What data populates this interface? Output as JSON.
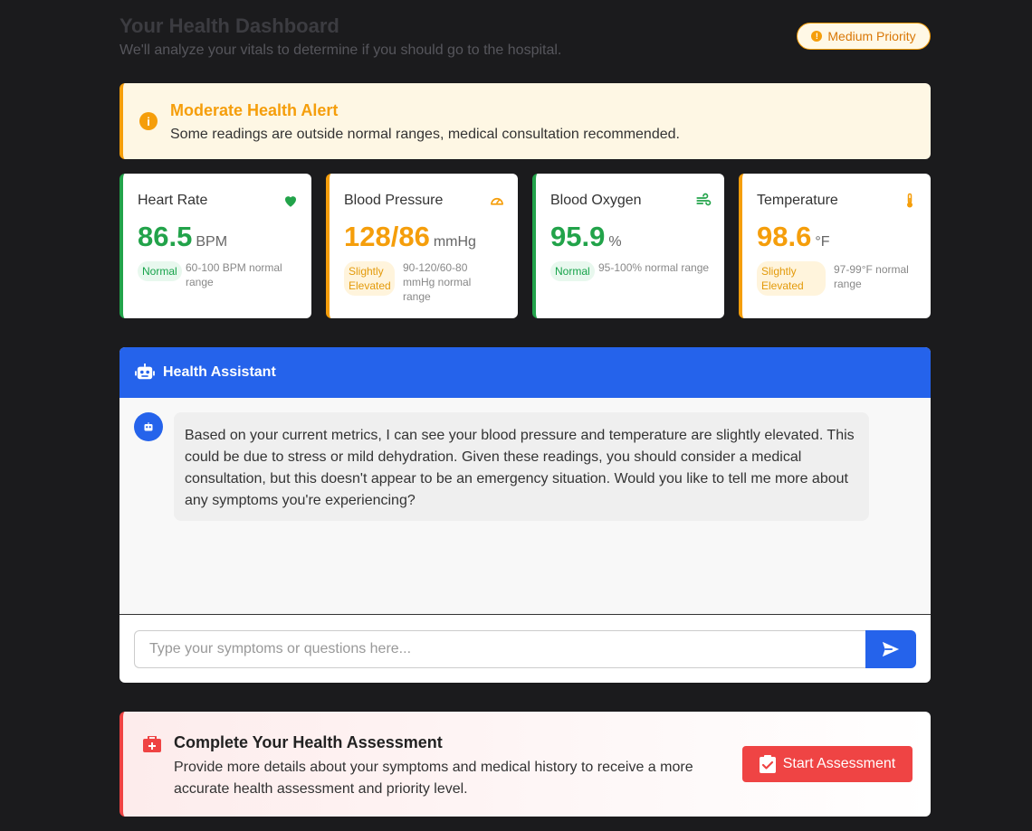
{
  "header": {
    "title": "Your Health Dashboard",
    "subtitle": "We'll analyze your vitals to determine if you should go to the hospital.",
    "priority_badge": "Medium Priority"
  },
  "alert": {
    "title": "Moderate Health Alert",
    "message": "Some readings are outside normal ranges, medical consultation recommended."
  },
  "vitals": [
    {
      "label": "Heart Rate",
      "value": "86.5",
      "unit": "BPM",
      "status": "Normal",
      "range": "60-100 BPM normal range",
      "icon": "heart-icon",
      "color": "#22a34a"
    },
    {
      "label": "Blood Pressure",
      "value": "128/86",
      "unit": "mmHg",
      "status": "Slightly Elevated",
      "range": "90-120/60-80 mmHg normal range",
      "icon": "gauge-icon",
      "color": "#f59e0b"
    },
    {
      "label": "Blood Oxygen",
      "value": "95.9",
      "unit": "%",
      "status": "Normal",
      "range": "95-100% normal range",
      "icon": "wind-icon",
      "color": "#22a34a"
    },
    {
      "label": "Temperature",
      "value": "98.6",
      "unit": "°F",
      "status": "Slightly Elevated",
      "range": "97-99°F normal range",
      "icon": "thermometer-icon",
      "color": "#f59e0b"
    }
  ],
  "chat": {
    "title": "Health Assistant",
    "message": "Based on your current metrics, I can see your blood pressure and temperature are slightly elevated. This could be due to stress or mild dehydration. Given these readings, you should consider a medical consultation, but this doesn't appear to be an emergency situation. Would you like to tell me more about any symptoms you're experiencing?",
    "input_value": "",
    "input_placeholder": "Type your symptoms or questions here..."
  },
  "assessment": {
    "title": "Complete Your Health Assessment",
    "text": "Provide more details about your symptoms and medical history to receive a more accurate health assessment and priority level.",
    "button_label": "Start Assessment"
  },
  "colors": {
    "background": "#1b1b1d",
    "accent_blue": "#2563eb",
    "normal_green": "#22a34a",
    "warning_amber": "#f59e0b",
    "danger_red": "#ef4444"
  }
}
